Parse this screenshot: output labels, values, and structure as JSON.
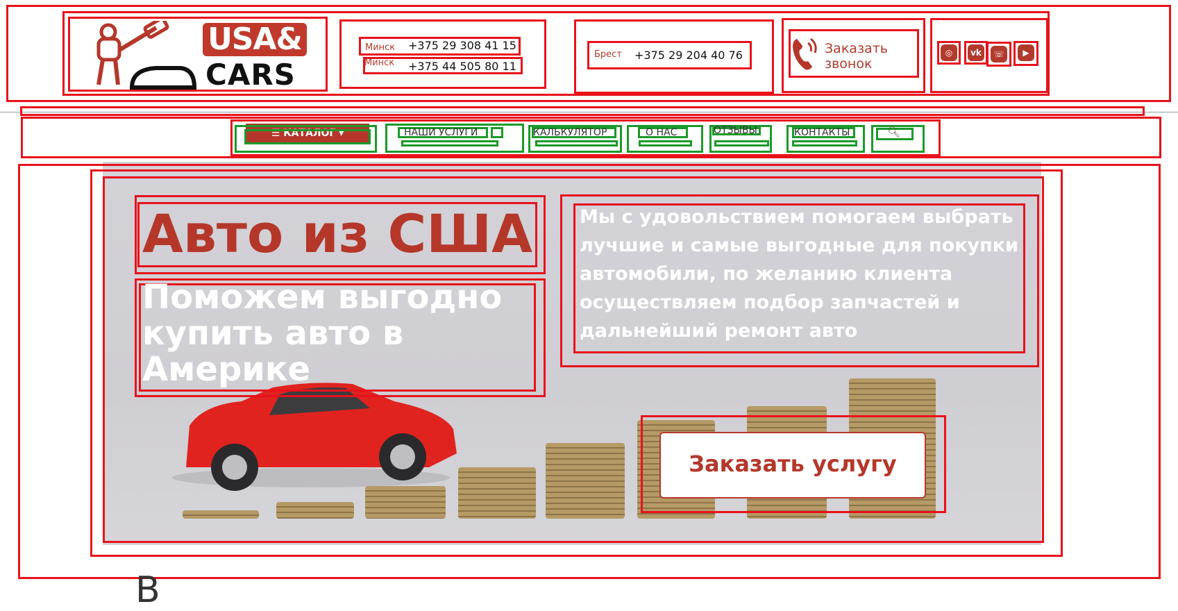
{
  "header": {
    "logo": {
      "line1": "USA&",
      "line2": "CARS"
    },
    "contacts": [
      {
        "city": "Минск",
        "phone": "+375 29 308 41 15"
      },
      {
        "city": "Минск",
        "phone": "+375 44 505 80 11"
      },
      {
        "city": "Брест",
        "phone": "+375 29 204 40 76"
      }
    ],
    "callback": {
      "line1": "Заказать",
      "line2": "звонок"
    },
    "social": [
      "instagram-icon",
      "vk-icon",
      "viber-icon",
      "youtube-icon"
    ]
  },
  "nav": {
    "catalog": "КАТАЛОГ",
    "items": [
      "НАШИ УСЛУГИ",
      "КАЛЬКУЛЯТОР",
      "О НАС",
      "ОТЗЫВЫ",
      "КОНТАКТЫ"
    ]
  },
  "hero": {
    "title": "Авто из США",
    "subtitle": "Поможем выгодно купить авто в Америке",
    "description": "Мы с удовольствием помогаем выбрать лучшие и самые выгодные для покупки автомобили, по желанию клиента осуществляем подбор запчастей и дальнейший ремонт авто",
    "cta": "Заказать услугу"
  },
  "below_fold": "В",
  "colors": {
    "accent": "#b5372a",
    "annotation_red": "#e8121b",
    "annotation_green": "#1a9a2a"
  }
}
